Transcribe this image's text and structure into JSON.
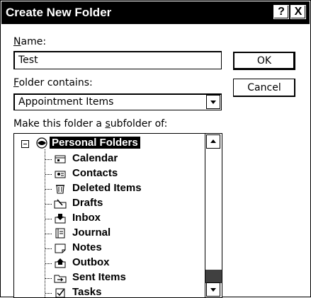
{
  "dialog": {
    "title": "Create New Folder",
    "help_button": "?",
    "close_button": "X"
  },
  "name": {
    "label_hotkey": "N",
    "label_rest": "ame:",
    "value": "Test"
  },
  "folder_contains": {
    "label_hotkey": "F",
    "label_rest": "older contains:",
    "selected": "Appointment Items"
  },
  "subfolder": {
    "label_prefix": "Make this folder a ",
    "label_hotkey": "s",
    "label_rest": "ubfolder of:"
  },
  "buttons": {
    "ok": "OK",
    "cancel": "Cancel"
  },
  "tree": {
    "root": {
      "label": "Personal Folders",
      "icon": "personal-folders-icon"
    },
    "items": [
      {
        "label": "Calendar",
        "icon": "calendar-icon"
      },
      {
        "label": "Contacts",
        "icon": "contacts-icon"
      },
      {
        "label": "Deleted Items",
        "icon": "deleted-items-icon"
      },
      {
        "label": "Drafts",
        "icon": "drafts-icon"
      },
      {
        "label": "Inbox",
        "icon": "inbox-icon"
      },
      {
        "label": "Journal",
        "icon": "journal-icon"
      },
      {
        "label": "Notes",
        "icon": "notes-icon"
      },
      {
        "label": "Outbox",
        "icon": "outbox-icon"
      },
      {
        "label": "Sent Items",
        "icon": "sent-items-icon"
      },
      {
        "label": "Tasks",
        "icon": "tasks-icon"
      }
    ]
  },
  "colors": {
    "titlebar": "#000000",
    "background": "#ffffff",
    "selection": "#000000"
  }
}
